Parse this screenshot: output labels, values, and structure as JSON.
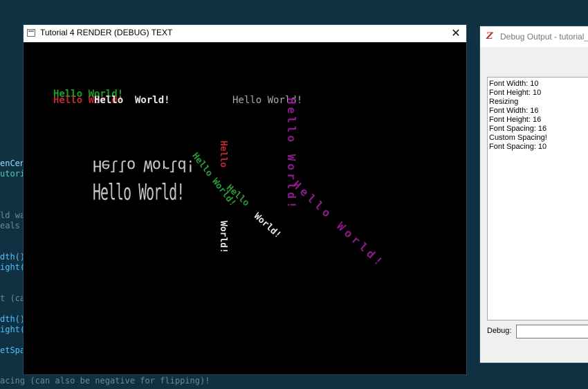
{
  "background_code": [
    {
      "text": "enCen",
      "color": "#9cdcfe"
    },
    {
      "text": "utoria",
      "color": "#4ec9b0"
    },
    {
      "text": "ld wa",
      "color": "#6a8a98"
    },
    {
      "text": "eals",
      "color": "#6a8a98"
    },
    {
      "text": "dth()",
      "color": "#4fc1ff"
    },
    {
      "text": "ight(",
      "color": "#4fc1ff"
    },
    {
      "text": "t (ca",
      "color": "#6a8a98"
    },
    {
      "text": "dth()",
      "color": "#4fc1ff"
    },
    {
      "text": "ight(",
      "color": "#4fc1ff"
    },
    {
      "text": "etSpa",
      "color": "#4fc1ff"
    },
    {
      "text": "acing (can also be negative for flipping)!",
      "color": "#6a8a98"
    }
  ],
  "main_window": {
    "title": "Tutorial 4 RENDER (DEBUG) TEXT",
    "close_label": "✕",
    "render_texts": [
      {
        "text": "Hello World!",
        "color": "#c0262d"
      },
      {
        "text": "Hello World!",
        "color": "#1f9a2a"
      },
      {
        "text": "Hello",
        "color": "#e8e8e8"
      },
      {
        "text": "World!",
        "color": "#e8e8e8"
      },
      {
        "text": "Hello World!",
        "color": "#a8a8a8"
      },
      {
        "text": "Hello World!",
        "color": "#c8c8c8"
      },
      {
        "text": "Hello World!",
        "color": "#c8c8c8"
      },
      {
        "text": "Hello World!",
        "color": "#2a9a35"
      },
      {
        "text": "Hello",
        "color": "#c0262d"
      },
      {
        "text": "World!",
        "color": "#e8e8e8"
      },
      {
        "text": "Hello",
        "color": "#2a9a35"
      },
      {
        "text": "World!",
        "color": "#e8e8e8"
      },
      {
        "text": "Hello World!",
        "color": "#8e1a8e"
      },
      {
        "text": "Hello World!",
        "color": "#8e1a8e"
      }
    ]
  },
  "debug_window": {
    "title": "Debug Output - tutorial_",
    "icon_letter": "Z",
    "log": [
      "Font Width:  10",
      "Font Height: 10",
      "Resizing",
      "Font Width:  16",
      "Font Height: 16",
      "Font Spacing: 16",
      "Custom Spacing!",
      "Font Spacing: 10"
    ],
    "input_label": "Debug:",
    "input_value": ""
  }
}
